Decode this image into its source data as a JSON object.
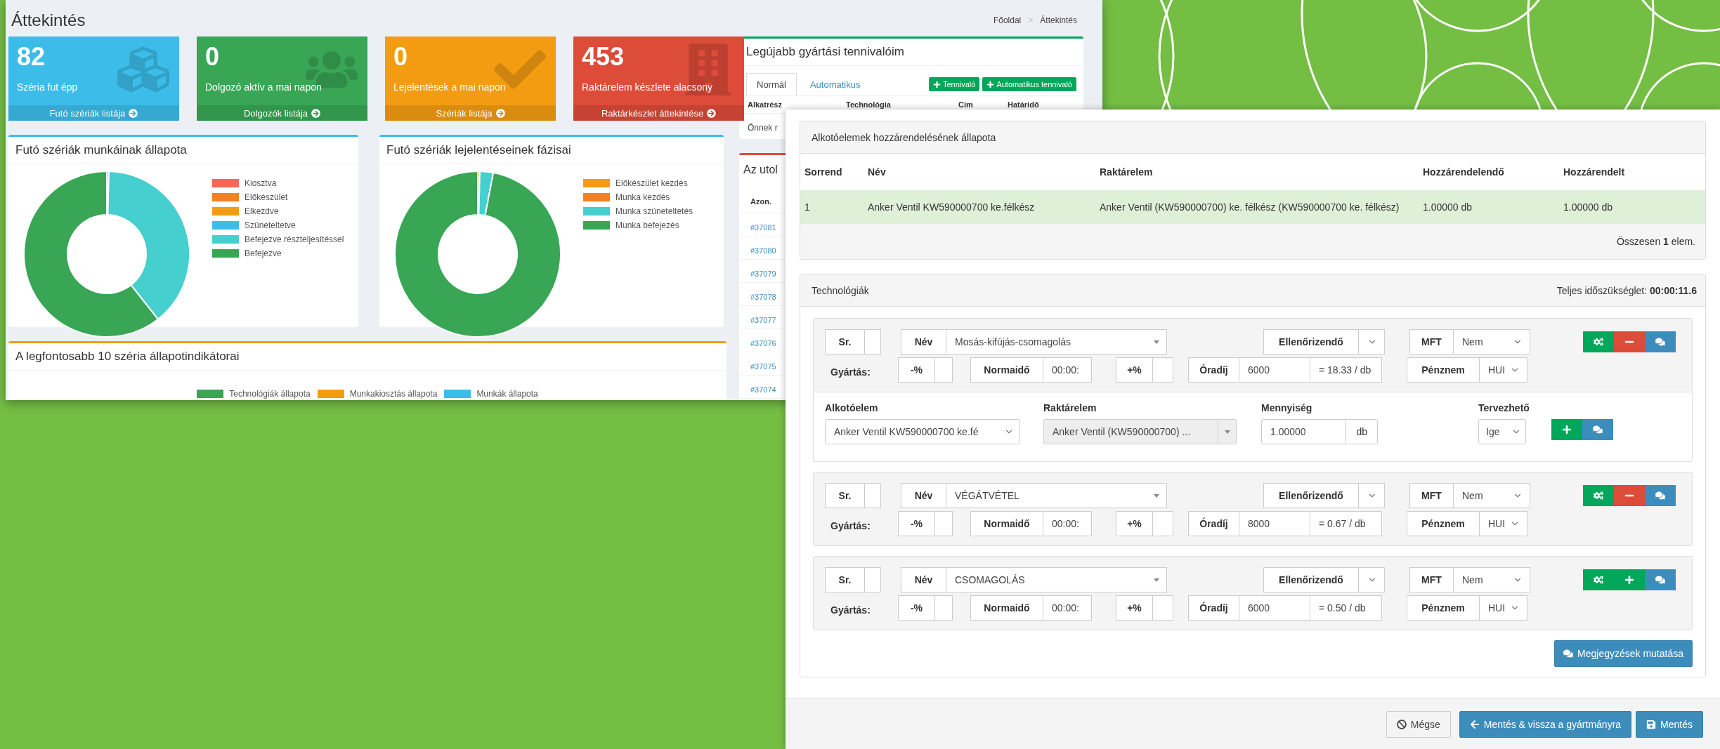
{
  "dashboard": {
    "title": "Áttekintés",
    "breadcrumb": [
      "Főoldal",
      "Áttekintés"
    ],
    "breadcrumb_separator": ">",
    "tiles": [
      {
        "value": "82",
        "label": "Széria fut épp",
        "link": "Futó szériák listája",
        "color": "#3cbde9"
      },
      {
        "value": "0",
        "label": "Dolgozó aktív a mai napon",
        "link": "Dolgozók listája",
        "color": "#38a655"
      },
      {
        "value": "0",
        "label": "Lejelentések a mai napon",
        "link": "Szériák listája",
        "color": "#f39c12"
      },
      {
        "value": "453",
        "label": "Raktárelem készlete alacsony",
        "link": "Raktárkészlet áttekintése",
        "color": "#dd4b39"
      }
    ],
    "charts": [
      {
        "title": "Futó szériák munkáinak állapota",
        "legend": [
          {
            "label": "Kiosztva",
            "color": "#f56954"
          },
          {
            "label": "Előkészület",
            "color": "#f7801f"
          },
          {
            "label": "Elkezdve",
            "color": "#f39c12"
          },
          {
            "label": "Szüneteltetve",
            "color": "#3cbde9"
          },
          {
            "label": "Befejezve részteljesítéssel",
            "color": "#45cfcf"
          },
          {
            "label": "Befejezve",
            "color": "#38a655"
          }
        ]
      },
      {
        "title": "Futó szériák lejelentéseinek fázisai",
        "legend": [
          {
            "label": "Előkészület kezdés",
            "color": "#f39c12"
          },
          {
            "label": "Munka kezdés",
            "color": "#f7801f"
          },
          {
            "label": "Munka szüneteltetés",
            "color": "#45cfcf"
          },
          {
            "label": "Munka befejezés",
            "color": "#38a655"
          }
        ]
      }
    ],
    "indicators": {
      "title": "A legfontosabb 10 széria állapotindikátorai",
      "legend": [
        {
          "label": "Technológiák állapota",
          "color": "#38a655"
        },
        {
          "label": "Munkakiosztás állapota",
          "color": "#f39c12"
        },
        {
          "label": "Munkák állapota",
          "color": "#3cbde9"
        }
      ]
    },
    "todo": {
      "title": "Legújabb gyártási tennivalóim",
      "tabs": [
        {
          "label": "Normál",
          "selected": true
        },
        {
          "label": "Automatikus",
          "selected": false
        }
      ],
      "buttons": [
        "Tennivaló",
        "Automatikus tennivaló"
      ],
      "columns": [
        "Alkatrész",
        "Technológia",
        "Cím",
        "Határidő"
      ],
      "empty_text": "Önnek r"
    },
    "recent": {
      "title": "Az utol",
      "column": "Azon.",
      "ids": [
        "#37081",
        "#37080",
        "#37079",
        "#37078",
        "#37077",
        "#37076",
        "#37075",
        "#37074"
      ]
    }
  },
  "form": {
    "assignment": {
      "title": "Alkotóelemek hozzárendelésének állapota",
      "columns": [
        "Sorrend",
        "Név",
        "Raktárelem",
        "Hozzárendelendő",
        "Hozzárendelt"
      ],
      "rows": [
        [
          "1",
          "Anker Ventil KW590000700 ke.félkész",
          "Anker Ventil (KW590000700) ke. félkész (KW590000700 ke. félkész)",
          "1.00000 db",
          "1.00000 db"
        ]
      ],
      "total": "Összesen **1** elem."
    },
    "technologies": {
      "title": "Technológiák",
      "total": "Teljes időszükséglet: **00:00:11.6**",
      "items": [
        {
          "sr": "Sr.",
          "name_label": "Név",
          "name": "Mosás-kifújás-csomagolás",
          "check_label": "Ellenőrizendő",
          "mft_label": "MFT",
          "mft": "Nem",
          "production_label": "Gyártás:",
          "minus_label": "-%",
          "normtime_label": "Normaidő",
          "normtime": "00:00:",
          "plus_label": "+%",
          "rate_label": "Óradíj",
          "rate": "6000",
          "per_unit": "= 18.33 / db",
          "currency_label": "Pénznem",
          "currency": "HUI",
          "actions": [
            {
              "kind": "gear"
            },
            {
              "kind": "remove"
            },
            {
              "kind": "comment"
            }
          ],
          "components": {
            "columns": [
              "Alkotóelem",
              "Raktárelem",
              "Mennyiség",
              "Tervezhető"
            ],
            "component": "Anker Ventil KW590000700 ke.fé",
            "stock_item": "Anker Ventil (KW590000700) ...",
            "stock_disabled": true,
            "quantity": "1.00000",
            "unit": "db",
            "plannable": "Ige",
            "actions": [
              {
                "kind": "add"
              },
              {
                "kind": "comment"
              }
            ]
          }
        },
        {
          "sr": "Sr.",
          "name_label": "Név",
          "name": "VÉGÁTVÉTEL",
          "check_label": "Ellenőrizendő",
          "mft_label": "MFT",
          "mft": "Nem",
          "production_label": "Gyártás:",
          "minus_label": "-%",
          "normtime_label": "Normaidő",
          "normtime": "00:00:",
          "plus_label": "+%",
          "rate_label": "Óradíj",
          "rate": "8000",
          "per_unit": "= 0.67 / db",
          "currency_label": "Pénznem",
          "currency": "HUI",
          "actions": [
            {
              "kind": "gear"
            },
            {
              "kind": "remove"
            },
            {
              "kind": "comment"
            }
          ]
        },
        {
          "sr": "Sr.",
          "name_label": "Név",
          "name": "CSOMAGOLÁS",
          "check_label": "Ellenőrizendő",
          "mft_label": "MFT",
          "mft": "Nem",
          "production_label": "Gyártás:",
          "minus_label": "-%",
          "normtime_label": "Normaidő",
          "normtime": "00:00:",
          "plus_label": "+%",
          "rate_label": "Óradíj",
          "rate": "6000",
          "per_unit": "= 0.50 / db",
          "currency_label": "Pénznem",
          "currency": "HUI",
          "actions": [
            {
              "kind": "gear"
            },
            {
              "kind": "add"
            },
            {
              "kind": "comment"
            }
          ]
        }
      ],
      "notes_button": "Megjegyzések mutatása"
    },
    "footer_buttons": [
      {
        "kind": "cancel",
        "label": "Mégse"
      },
      {
        "kind": "back",
        "label": "Mentés & vissza a gyártmányra"
      },
      {
        "kind": "save",
        "label": "Mentés"
      }
    ]
  }
}
